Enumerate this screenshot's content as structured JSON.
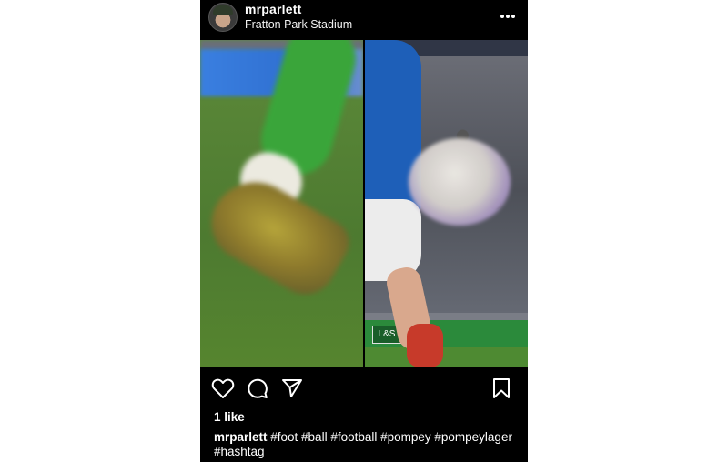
{
  "post": {
    "username": "mrparlett",
    "location": "Fratton Park Stadium",
    "likes": "1 like",
    "caption_user": "mrparlett",
    "caption_text": " #foot #ball #football #pompey #pompeylager #hashtag",
    "board_logo_text": "L&S"
  },
  "icons": {
    "more": "more-options-icon",
    "like": "heart-icon",
    "comment": "comment-icon",
    "share": "send-icon",
    "save": "bookmark-icon"
  },
  "colors": {
    "background": "#000000",
    "text": "#ffffff",
    "page": "#ffffff"
  }
}
